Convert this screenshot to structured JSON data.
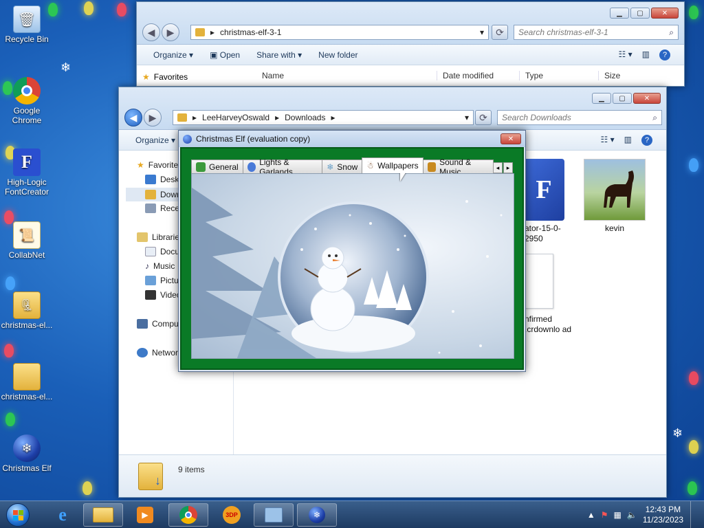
{
  "desktop": {
    "icons": [
      {
        "label": "Recycle Bin",
        "icon": "recycle-bin-icon"
      },
      {
        "label": "Google Chrome",
        "icon": "chrome-icon"
      },
      {
        "label": "High-Logic FontCreator",
        "icon": "fontcreator-icon"
      },
      {
        "label": "CollabNet",
        "icon": "certificate-icon"
      },
      {
        "label": "christmas-el...",
        "icon": "zip-folder-icon"
      },
      {
        "label": "christmas-el...",
        "icon": "folder-icon"
      },
      {
        "label": "Christmas Elf",
        "icon": "christmas-ornament-icon"
      }
    ]
  },
  "explorer_back": {
    "path": "christmas-elf-3-1",
    "search_placeholder": "Search christmas-elf-3-1",
    "commands": [
      "Organize",
      "Open",
      "Share with",
      "New folder"
    ],
    "columns": [
      "Name",
      "Date modified",
      "Type",
      "Size"
    ],
    "favorites_label": "Favorites"
  },
  "explorer_front": {
    "path_parts": [
      "LeeHarveyOswald",
      "Downloads"
    ],
    "search_placeholder": "Search Downloads",
    "organize": "Organize",
    "nav": [
      "Favorite",
      "Deskt",
      "Down",
      "Recen",
      "Librarie",
      "Docu",
      "Music",
      "Pictu",
      "Video",
      "Compu",
      "Networ"
    ],
    "files": [
      {
        "label": "ator-15-0-2950"
      },
      {
        "label": "kevin"
      },
      {
        "label": "nfirmed .crdownlo ad"
      }
    ],
    "status": "9 items"
  },
  "elf_dialog": {
    "title": "Christmas Elf (evaluation copy)",
    "tabs": [
      "General",
      "Lights & Garlands",
      "Snow",
      "Wallpapers",
      "Sound & Music"
    ],
    "selected_tab": "Wallpapers"
  },
  "taskbar": {
    "time": "12:43 PM",
    "date": "11/23/2023"
  }
}
